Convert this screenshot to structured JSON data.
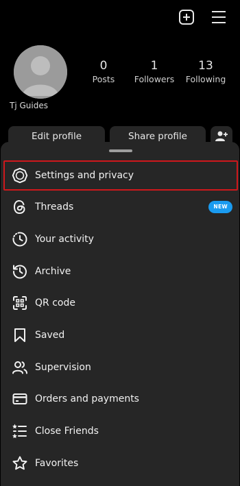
{
  "header": {
    "icons": [
      "add-post-icon",
      "hamburger-menu-icon"
    ]
  },
  "profile": {
    "username": "Tj Guides",
    "stats": [
      {
        "value": "0",
        "label": "Posts"
      },
      {
        "value": "1",
        "label": "Followers"
      },
      {
        "value": "13",
        "label": "Following"
      }
    ],
    "edit_label": "Edit profile",
    "share_label": "Share profile"
  },
  "menu": {
    "items": [
      {
        "label": "Settings and privacy",
        "icon": "settings-gear-icon",
        "highlighted": true
      },
      {
        "label": "Threads",
        "icon": "threads-icon",
        "badge": "NEW"
      },
      {
        "label": "Your activity",
        "icon": "activity-icon"
      },
      {
        "label": "Archive",
        "icon": "archive-icon"
      },
      {
        "label": "QR code",
        "icon": "qr-code-icon"
      },
      {
        "label": "Saved",
        "icon": "bookmark-icon"
      },
      {
        "label": "Supervision",
        "icon": "supervision-icon"
      },
      {
        "label": "Orders and payments",
        "icon": "credit-card-icon"
      },
      {
        "label": "Close Friends",
        "icon": "close-friends-icon"
      },
      {
        "label": "Favorites",
        "icon": "star-icon"
      }
    ]
  },
  "colors": {
    "background": "#000000",
    "sheet": "#262626",
    "highlight_border": "#d0181c",
    "badge": "#1a9bf0"
  }
}
